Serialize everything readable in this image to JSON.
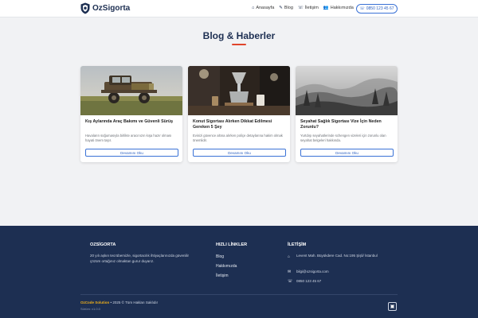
{
  "nav": {
    "brand": "OzSigorta",
    "links": [
      {
        "label": "Anasayfa",
        "icon": "home-icon"
      },
      {
        "label": "Blog",
        "icon": "edit-icon"
      },
      {
        "label": "İletişim",
        "icon": "phone-icon"
      },
      {
        "label": "Hakkımızda",
        "icon": "users-icon"
      }
    ],
    "phone": "0850 123 45 67"
  },
  "page": {
    "title": "Blog & Haberler",
    "accent": "#e0452b"
  },
  "posts": [
    {
      "title": "Kış Aylarında Araç Bakımı ve Güvenli Sürüş",
      "excerpt": "Havaların soğumasıyla birlikte aracınızın kışa hazır olması hayati önem taşır.",
      "button": "Devamını Oku",
      "image": "vintage-truck-photo"
    },
    {
      "title": "Konut Sigortası Alırken Dikkat Edilmesi Gereken 5 Şey",
      "excerpt": "Evinizi güvence altına alırken poliçe detaylarına hakim olmak önemlidir.",
      "button": "Devamını Oku",
      "image": "coffee-bar-photo"
    },
    {
      "title": "Seyahat Sağlık Sigortası Vize İçin Neden Zorunlu?",
      "excerpt": "Yurtdışı seyahatlerinde schengen vizeleri için zorunlu olan seyahat belgeleri hakkında.",
      "button": "Devamını Oku",
      "image": "foggy-forest-photo"
    }
  ],
  "footer": {
    "about": {
      "title": "OZSİGORTA",
      "text": "20 yılı aşkın tecrübemizle, sigortacılık ihtiyaçlarınızda güvenilir çözüm ortağınız olmaktan gurur duyarız."
    },
    "quick_links": {
      "title": "HIZLI LİNKLER",
      "items": [
        "Blog",
        "Hakkımızda",
        "İletişim"
      ]
    },
    "contact": {
      "title": "İLETİŞİM",
      "address": "Levent Mah. Büyükdere Cad. No:195 Şişli/ İstanbul",
      "email": "bilgi@ozsigorta.com",
      "phone": "0850 123 45 67"
    },
    "copyright_brand": "OzCode Solution",
    "copyright_rest": "• 2025 © Tüm Hakları Saklıdır",
    "version": "Sürüm: v1.0.0"
  },
  "colors": {
    "navy": "#1d2f52",
    "accent_blue": "#3a72d6",
    "footer_brand": "#f2b21a"
  }
}
